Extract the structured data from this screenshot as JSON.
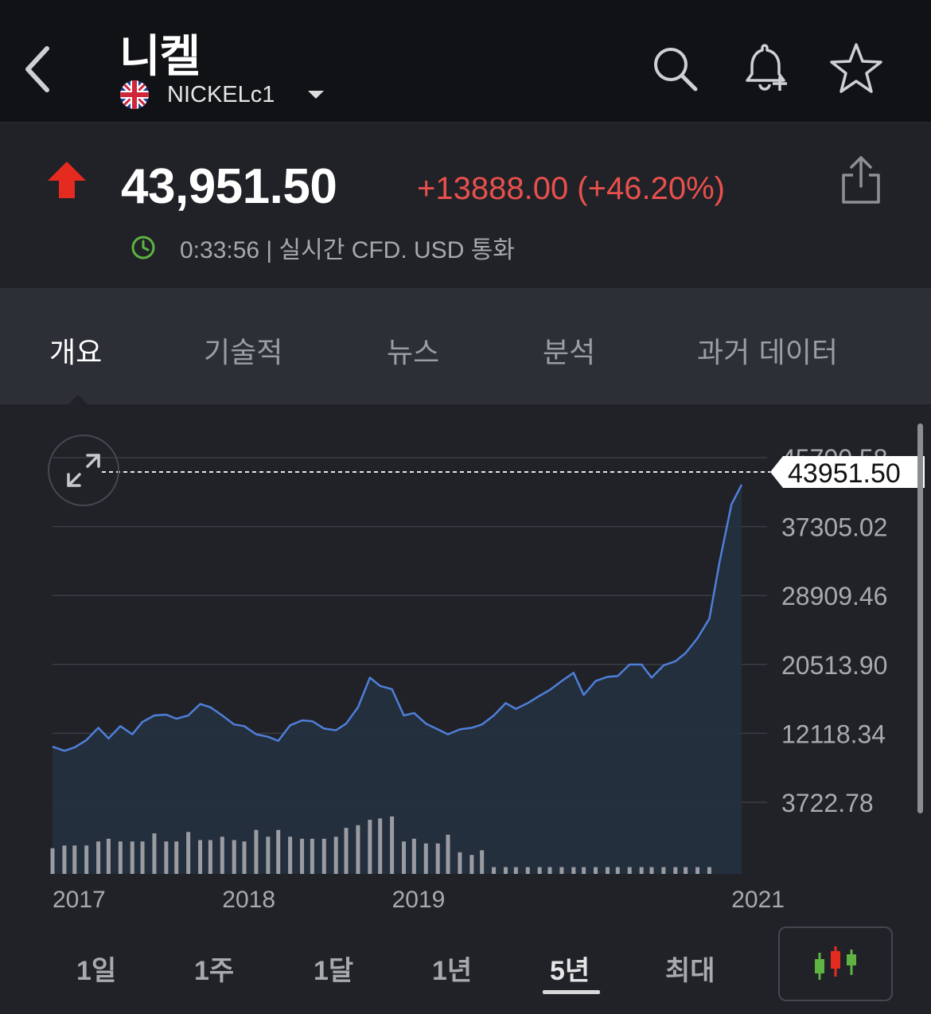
{
  "header": {
    "title": "니켈",
    "symbol": "NICKELc1",
    "back_icon": "chevron-left-icon",
    "search_icon": "search-icon",
    "alert_icon": "bell-plus-icon",
    "favorite_icon": "star-icon"
  },
  "quote": {
    "price": "43,951.50",
    "change": "+13888.00 (+46.20%)",
    "status": "0:33:56 | 실시간 CFD. USD 통화",
    "direction_icon": "arrow-up-icon",
    "colors": {
      "positive": "#e8504d",
      "clock": "#5fb342"
    }
  },
  "tabs": [
    {
      "label": "개요",
      "active": true
    },
    {
      "label": "기술적",
      "active": false
    },
    {
      "label": "뉴스",
      "active": false
    },
    {
      "label": "분석",
      "active": false
    },
    {
      "label": "과거 데이터",
      "active": false
    }
  ],
  "chart_data": {
    "type": "area",
    "y_tick_labels": [
      "45700.58",
      "37305.02",
      "28909.46",
      "20513.90",
      "12118.34",
      "3722.78"
    ],
    "y_ticks": [
      45700.58,
      37305.02,
      28909.46,
      20513.9,
      12118.34,
      3722.78
    ],
    "x_tick_labels": [
      "2017",
      "2018",
      "2019",
      "2021"
    ],
    "x_tick_dates": [
      2017.0,
      2018.0,
      2019.0,
      2021.0
    ],
    "x_range": [
      2017.0,
      2021.21
    ],
    "last_price_label": "43951.50",
    "last_price": 43951.5,
    "line_color": "#4f7fd9",
    "grid": true,
    "series": [
      {
        "values": [
          [
            2017.0,
            10500
          ],
          [
            2017.07,
            10000
          ],
          [
            2017.13,
            10400
          ],
          [
            2017.2,
            11300
          ],
          [
            2017.27,
            12800
          ],
          [
            2017.33,
            11500
          ],
          [
            2017.4,
            13000
          ],
          [
            2017.47,
            12000
          ],
          [
            2017.53,
            13500
          ],
          [
            2017.6,
            14300
          ],
          [
            2017.67,
            14400
          ],
          [
            2017.73,
            13900
          ],
          [
            2017.8,
            14300
          ],
          [
            2017.87,
            15700
          ],
          [
            2017.93,
            15300
          ],
          [
            2018.0,
            14300
          ],
          [
            2018.07,
            13200
          ],
          [
            2018.13,
            13000
          ],
          [
            2018.2,
            12000
          ],
          [
            2018.27,
            11700
          ],
          [
            2018.33,
            11200
          ],
          [
            2018.4,
            13100
          ],
          [
            2018.47,
            13700
          ],
          [
            2018.53,
            13600
          ],
          [
            2018.6,
            12700
          ],
          [
            2018.67,
            12500
          ],
          [
            2018.73,
            13300
          ],
          [
            2018.8,
            15300
          ],
          [
            2018.87,
            18900
          ],
          [
            2018.93,
            17900
          ],
          [
            2019.0,
            17500
          ],
          [
            2019.07,
            14300
          ],
          [
            2019.13,
            14600
          ],
          [
            2019.2,
            13300
          ],
          [
            2019.27,
            12600
          ],
          [
            2019.33,
            12000
          ],
          [
            2019.4,
            12600
          ],
          [
            2019.47,
            12800
          ],
          [
            2019.53,
            13200
          ],
          [
            2019.6,
            14300
          ],
          [
            2019.67,
            15800
          ],
          [
            2019.73,
            15100
          ],
          [
            2019.8,
            15800
          ],
          [
            2019.87,
            16700
          ],
          [
            2019.93,
            17400
          ],
          [
            2020.0,
            18500
          ],
          [
            2020.07,
            19500
          ],
          [
            2020.13,
            16800
          ],
          [
            2020.2,
            18500
          ],
          [
            2020.27,
            19000
          ],
          [
            2020.33,
            19100
          ],
          [
            2020.4,
            20500
          ],
          [
            2020.47,
            20500
          ],
          [
            2020.53,
            18900
          ],
          [
            2020.6,
            20400
          ],
          [
            2020.67,
            20900
          ],
          [
            2020.73,
            21900
          ],
          [
            2020.8,
            23700
          ],
          [
            2020.87,
            26100
          ],
          [
            2020.93,
            33000
          ],
          [
            2021.0,
            40000
          ],
          [
            2021.06,
            42400
          ]
        ]
      }
    ],
    "volume": [
      [
        2017.0,
        38
      ],
      [
        2017.07,
        42
      ],
      [
        2017.13,
        42
      ],
      [
        2017.2,
        42
      ],
      [
        2017.27,
        48
      ],
      [
        2017.33,
        52
      ],
      [
        2017.4,
        48
      ],
      [
        2017.47,
        48
      ],
      [
        2017.53,
        48
      ],
      [
        2017.6,
        60
      ],
      [
        2017.67,
        48
      ],
      [
        2017.73,
        48
      ],
      [
        2017.8,
        62
      ],
      [
        2017.87,
        50
      ],
      [
        2017.93,
        50
      ],
      [
        2018.0,
        55
      ],
      [
        2018.07,
        50
      ],
      [
        2018.13,
        48
      ],
      [
        2018.2,
        65
      ],
      [
        2018.27,
        55
      ],
      [
        2018.33,
        65
      ],
      [
        2018.4,
        55
      ],
      [
        2018.47,
        52
      ],
      [
        2018.53,
        52
      ],
      [
        2018.6,
        52
      ],
      [
        2018.67,
        55
      ],
      [
        2018.73,
        68
      ],
      [
        2018.8,
        72
      ],
      [
        2018.87,
        80
      ],
      [
        2018.93,
        82
      ],
      [
        2019.0,
        85
      ],
      [
        2019.07,
        48
      ],
      [
        2019.13,
        52
      ],
      [
        2019.2,
        45
      ],
      [
        2019.27,
        45
      ],
      [
        2019.33,
        58
      ],
      [
        2019.4,
        32
      ],
      [
        2019.47,
        28
      ],
      [
        2019.53,
        35
      ],
      [
        2019.6,
        10
      ],
      [
        2019.67,
        10
      ],
      [
        2019.73,
        10
      ],
      [
        2019.8,
        10
      ],
      [
        2019.87,
        10
      ],
      [
        2019.93,
        10
      ],
      [
        2020.0,
        10
      ],
      [
        2020.07,
        10
      ],
      [
        2020.13,
        10
      ],
      [
        2020.2,
        10
      ],
      [
        2020.27,
        10
      ],
      [
        2020.33,
        10
      ],
      [
        2020.4,
        10
      ],
      [
        2020.47,
        10
      ],
      [
        2020.53,
        10
      ],
      [
        2020.6,
        10
      ],
      [
        2020.67,
        10
      ],
      [
        2020.73,
        10
      ],
      [
        2020.8,
        10
      ],
      [
        2020.87,
        10
      ]
    ]
  },
  "periods": [
    {
      "label": "1일",
      "active": false
    },
    {
      "label": "1주",
      "active": false
    },
    {
      "label": "1달",
      "active": false
    },
    {
      "label": "1년",
      "active": false
    },
    {
      "label": "5년",
      "active": true
    },
    {
      "label": "최대",
      "active": false
    }
  ],
  "controls": {
    "expand_icon": "expand-icon",
    "share_icon": "share-icon",
    "chart_type_icon": "candlestick-icon",
    "flag_icon": "uk-flag-icon"
  }
}
